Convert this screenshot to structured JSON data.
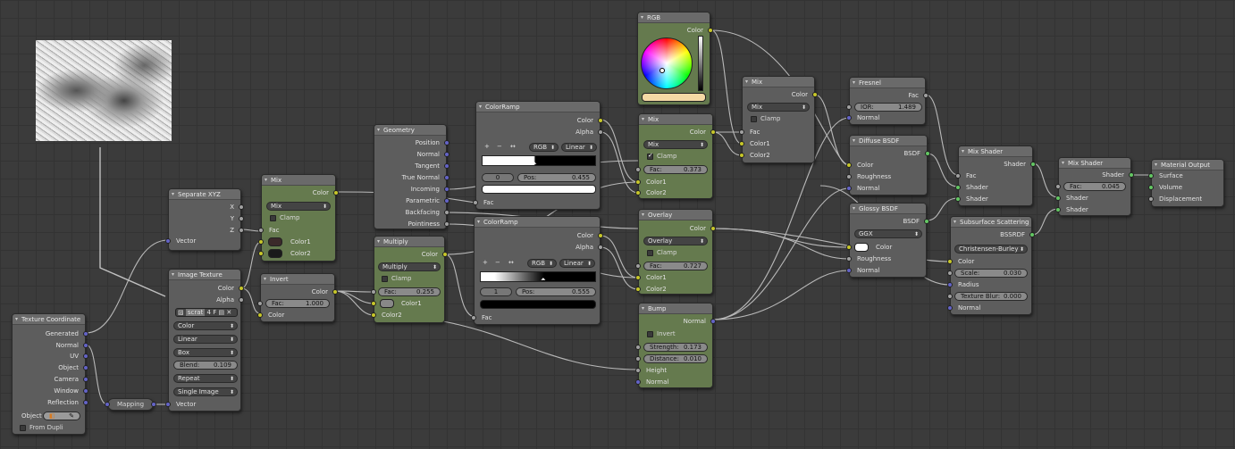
{
  "image_preview": {
    "description": "scratches texture"
  },
  "nodes": {
    "texcoord": {
      "title": "Texture Coordinate",
      "outputs": [
        "Generated",
        "Normal",
        "UV",
        "Object",
        "Camera",
        "Window",
        "Reflection"
      ],
      "object_label": "Object",
      "from_dupli": "From Dupli"
    },
    "mapping": {
      "title": "Mapping"
    },
    "imgtex": {
      "title": "Image Texture",
      "outputs": [
        "Color",
        "Alpha"
      ],
      "image_name": "scrat",
      "users": "4",
      "fake_label": "F",
      "color_space": "Color",
      "interp": "Linear",
      "projection": "Box",
      "blend_label": "Blend:",
      "blend_value": "0.109",
      "extension": "Repeat",
      "source": "Single Image",
      "input_vector": "Vector"
    },
    "sepxyz": {
      "title": "Separate XYZ",
      "outputs": [
        "X",
        "Y",
        "Z"
      ],
      "input": "Vector"
    },
    "mix1": {
      "title": "Mix",
      "output": "Color",
      "mode": "Mix",
      "clamp": "Clamp",
      "inputs": [
        "Fac",
        "Color1",
        "Color2"
      ]
    },
    "invert": {
      "title": "Invert",
      "output": "Color",
      "fac_label": "Fac:",
      "fac_value": "1.000",
      "input_color": "Color"
    },
    "geometry": {
      "title": "Geometry",
      "outputs": [
        "Position",
        "Normal",
        "Tangent",
        "True Normal",
        "Incoming",
        "Parametric",
        "Backfacing",
        "Pointiness"
      ]
    },
    "multiply": {
      "title": "Multiply",
      "output": "Color",
      "mode": "Multiply",
      "clamp": "Clamp",
      "fac_label": "Fac:",
      "fac_value": "0.255",
      "inputs": [
        "Color1",
        "Color2"
      ]
    },
    "ramp1": {
      "title": "ColorRamp",
      "outputs": [
        "Color",
        "Alpha"
      ],
      "plus": "+",
      "minus": "−",
      "flip": "↔",
      "mode": "RGB",
      "interp": "Linear",
      "index": "0",
      "pos_label": "Pos:",
      "pos_value": "0.455",
      "input": "Fac"
    },
    "ramp2": {
      "title": "ColorRamp",
      "outputs": [
        "Color",
        "Alpha"
      ],
      "plus": "+",
      "minus": "−",
      "flip": "↔",
      "mode": "RGB",
      "interp": "Linear",
      "index": "1",
      "pos_label": "Pos:",
      "pos_value": "0.555",
      "input": "Fac"
    },
    "rgb": {
      "title": "RGB",
      "output": "Color"
    },
    "mix2": {
      "title": "Mix",
      "output": "Color",
      "mode": "Mix",
      "clamp": "Clamp",
      "fac_label": "Fac:",
      "fac_value": "0.373",
      "inputs": [
        "Color1",
        "Color2"
      ]
    },
    "overlay": {
      "title": "Overlay",
      "output": "Color",
      "mode": "Overlay",
      "clamp": "Clamp",
      "fac_label": "Fac:",
      "fac_value": "0.727",
      "inputs": [
        "Color1",
        "Color2"
      ]
    },
    "bump": {
      "title": "Bump",
      "output": "Normal",
      "invert": "Invert",
      "strength_label": "Strength:",
      "strength_value": "0.173",
      "distance_label": "Distance:",
      "distance_value": "0.010",
      "inputs": [
        "Height",
        "Normal"
      ]
    },
    "mix3": {
      "title": "Mix",
      "output": "Color",
      "mode": "Mix",
      "clamp": "Clamp",
      "inputs": [
        "Fac",
        "Color1",
        "Color2"
      ]
    },
    "fresnel": {
      "title": "Fresnel",
      "output": "Fac",
      "ior_label": "IOR:",
      "ior_value": "1.489",
      "input": "Normal"
    },
    "diffuse": {
      "title": "Diffuse BSDF",
      "output": "BSDF",
      "inputs": [
        "Color",
        "Roughness",
        "Normal"
      ]
    },
    "glossy": {
      "title": "Glossy BSDF",
      "output": "BSDF",
      "dist": "GGX",
      "inputs": [
        "Color",
        "Roughness",
        "Normal"
      ]
    },
    "mixsh1": {
      "title": "Mix Shader",
      "output": "Shader",
      "inputs": [
        "Fac",
        "Shader",
        "Shader"
      ]
    },
    "sss": {
      "title": "Subsurface Scattering",
      "output": "BSSRDF",
      "falloff": "Christensen-Burley",
      "inputs": [
        "Color"
      ],
      "scale_label": "Scale:",
      "scale_value": "0.030",
      "radius": "Radius",
      "blur_label": "Texture Blur:",
      "blur_value": "0.000",
      "normal": "Normal"
    },
    "mixsh2": {
      "title": "Mix Shader",
      "output": "Shader",
      "fac_label": "Fac:",
      "fac_value": "0.045",
      "inputs": [
        "Shader",
        "Shader"
      ]
    },
    "output": {
      "title": "Material Output",
      "inputs": [
        "Surface",
        "Volume",
        "Displacement"
      ]
    }
  },
  "colors": {
    "node_gray": "#5d5d5d",
    "node_green": "#657a4e",
    "socket_color": "#c7c729",
    "socket_vector": "#6363c7",
    "socket_shader": "#63c763",
    "rgb_swatch": "#f4d9a4"
  }
}
